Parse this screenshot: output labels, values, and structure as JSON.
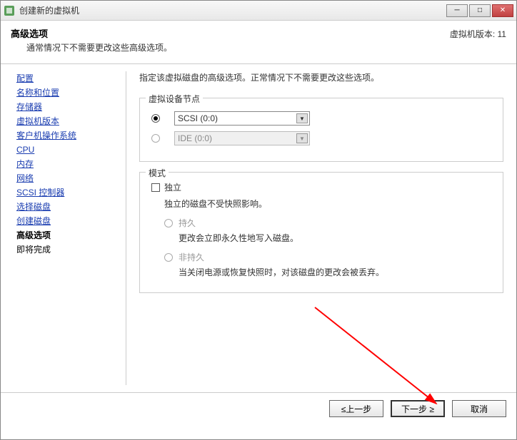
{
  "window": {
    "title": "创建新的虚拟机"
  },
  "header": {
    "title": "高级选项",
    "subtitle": "通常情况下不需要更改这些高级选项。",
    "version_label": "虚拟机版本: 11"
  },
  "sidebar": {
    "items": [
      {
        "label": "配置"
      },
      {
        "label": "名称和位置"
      },
      {
        "label": "存储器"
      },
      {
        "label": "虚拟机版本"
      },
      {
        "label": "客户机操作系统"
      },
      {
        "label": "CPU"
      },
      {
        "label": "内存"
      },
      {
        "label": "网络"
      },
      {
        "label": "SCSI 控制器"
      },
      {
        "label": "选择磁盘"
      },
      {
        "label": "创建磁盘"
      },
      {
        "label": "高级选项"
      },
      {
        "label": "即将完成"
      }
    ]
  },
  "content": {
    "description": "指定该虚拟磁盘的高级选项。正常情况下不需要更改这些选项。",
    "device_node": {
      "legend": "虚拟设备节点",
      "scsi_value": "SCSI (0:0)",
      "ide_value": "IDE (0:0)"
    },
    "mode": {
      "legend": "模式",
      "independent": "独立",
      "independent_desc": "独立的磁盘不受快照影响。",
      "persistent": "持久",
      "persistent_desc": "更改会立即永久性地写入磁盘。",
      "nonpersistent": "非持久",
      "nonpersistent_desc": "当关闭电源或恢复快照时，对该磁盘的更改会被丢弃。"
    }
  },
  "footer": {
    "back": "≤上一步",
    "next": "下一步 ≥",
    "cancel": "取消"
  }
}
